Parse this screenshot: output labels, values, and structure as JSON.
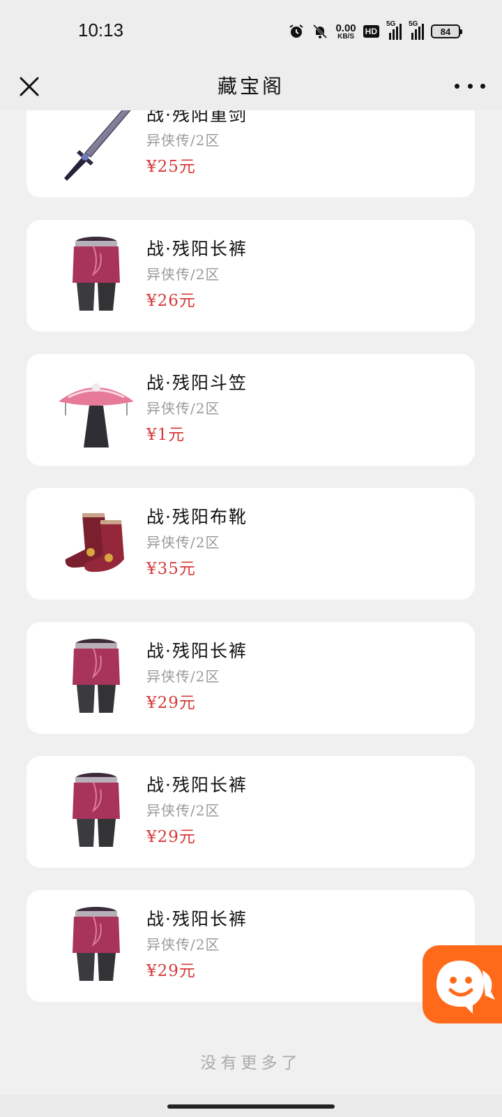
{
  "status_bar": {
    "time": "10:13",
    "net_speed_value": "0.00",
    "net_speed_unit": "KB/S",
    "hd_label": "HD",
    "signal_1_label": "5G",
    "signal_2_label": "5G",
    "battery": "84"
  },
  "nav": {
    "title": "藏宝阁"
  },
  "items": [
    {
      "name": "战·残阳重剑",
      "server": "异侠传/2区",
      "price": "¥25元",
      "icon": "sword-icon"
    },
    {
      "name": "战·残阳长裤",
      "server": "异侠传/2区",
      "price": "¥26元",
      "icon": "pants-icon"
    },
    {
      "name": "战·残阳斗笠",
      "server": "异侠传/2区",
      "price": "¥1元",
      "icon": "hat-icon"
    },
    {
      "name": "战·残阳布靴",
      "server": "异侠传/2区",
      "price": "¥35元",
      "icon": "boots-icon"
    },
    {
      "name": "战·残阳长裤",
      "server": "异侠传/2区",
      "price": "¥29元",
      "icon": "pants-icon"
    },
    {
      "name": "战·残阳长裤",
      "server": "异侠传/2区",
      "price": "¥29元",
      "icon": "pants-icon"
    },
    {
      "name": "战·残阳长裤",
      "server": "异侠传/2区",
      "price": "¥29元",
      "icon": "pants-icon"
    }
  ],
  "footer": {
    "no_more": "没有更多了"
  },
  "colors": {
    "price": "#d63a3a",
    "chat_fab": "#ff6a1a",
    "background": "#f0f0f0"
  }
}
